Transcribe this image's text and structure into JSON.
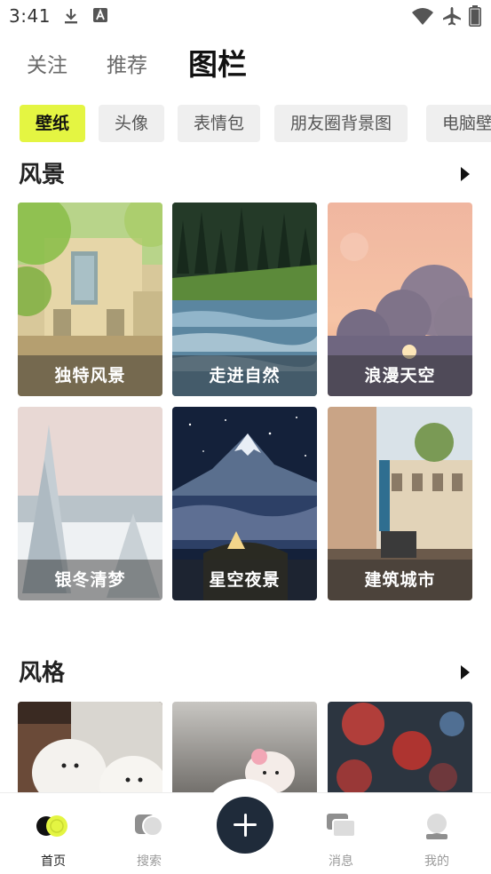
{
  "status_bar": {
    "time": "3:41",
    "icons": [
      "download-icon",
      "text-a-icon",
      "wifi-icon",
      "airplane-icon",
      "battery-icon"
    ]
  },
  "top_tabs": [
    {
      "label": "关注",
      "active": false
    },
    {
      "label": "推荐",
      "active": false
    },
    {
      "label": "图栏",
      "active": true
    }
  ],
  "categories": [
    {
      "label": "壁纸",
      "active": true
    },
    {
      "label": "头像",
      "active": false
    },
    {
      "label": "表情包",
      "active": false
    },
    {
      "label": "朋友圈背景图",
      "active": false
    },
    {
      "label": "电脑壁",
      "active": false
    }
  ],
  "sections": [
    {
      "title": "风景",
      "cards": [
        {
          "caption": "独特风景"
        },
        {
          "caption": "走进自然"
        },
        {
          "caption": "浪漫天空"
        },
        {
          "caption": "银冬清梦"
        },
        {
          "caption": "星空夜景"
        },
        {
          "caption": "建筑城市"
        }
      ]
    },
    {
      "title": "风格",
      "cards": [
        {
          "caption": ""
        },
        {
          "caption": ""
        },
        {
          "caption": ""
        }
      ]
    }
  ],
  "bottom_nav": [
    {
      "label": "首页",
      "icon": "home-icon",
      "active": true
    },
    {
      "label": "搜索",
      "icon": "search-icon",
      "active": false
    },
    {
      "label": "",
      "icon": "plus-icon",
      "active": false
    },
    {
      "label": "消息",
      "icon": "message-icon",
      "active": false
    },
    {
      "label": "我的",
      "icon": "profile-icon",
      "active": false
    }
  ],
  "colors": {
    "accent": "#e4f542",
    "fab": "#1f2b3a"
  }
}
